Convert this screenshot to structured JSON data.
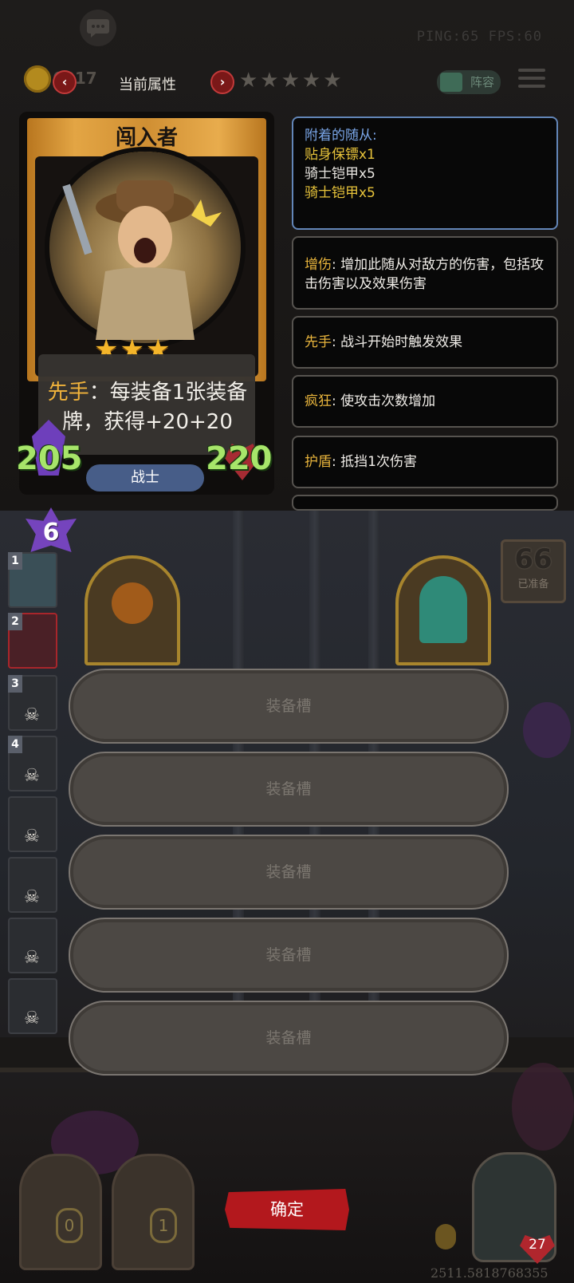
{
  "top_bar": {
    "ping_fps": "PING:65   FPS:60",
    "gold_value": "6017",
    "attr_title": "当前属性",
    "prev_arrow": "‹",
    "next_arrow": "›",
    "star_glyphs": "★★★★★",
    "lineup_label": "阵容"
  },
  "card": {
    "name": "闯入者",
    "stars": "★★★",
    "skill_keyword": "先手",
    "skill_text": "：每装备1张装备牌，获得+20+20",
    "attack": "205",
    "health": "220",
    "class_label": "战士"
  },
  "info_panels": {
    "attached_title": "附着的随从:",
    "attached_items": [
      "贴身保镖x1",
      "骑士铠甲x5",
      "骑士铠甲x5"
    ],
    "keywords": [
      {
        "kw": "增伤",
        "desc": ": 增加此随从对敌方的伤害，包括攻击伤害以及效果伤害"
      },
      {
        "kw": "先手",
        "desc": ": 战斗开始时触发效果"
      },
      {
        "kw": "疯狂",
        "desc": ": 使攻击次数增加"
      },
      {
        "kw": "护盾",
        "desc": ": 抵挡1次伤害"
      }
    ]
  },
  "board": {
    "tier": "6",
    "slot_numbers": [
      "1",
      "2",
      "3",
      "4"
    ],
    "ready_count": "66",
    "ready_label": "已准备"
  },
  "equip_slots": [
    "装备槽",
    "装备槽",
    "装备槽",
    "装备槽",
    "装备槽"
  ],
  "bottom": {
    "confirm_label": "确定",
    "chest_left": "0",
    "chest_right": "1",
    "heart_value": "27",
    "coords_text": "2511.5818768355"
  },
  "colors": {
    "keyword": "#e8b43c",
    "attack_health": "#a7e56a",
    "confirm": "#b3181d",
    "class_pill": "#475d88"
  }
}
